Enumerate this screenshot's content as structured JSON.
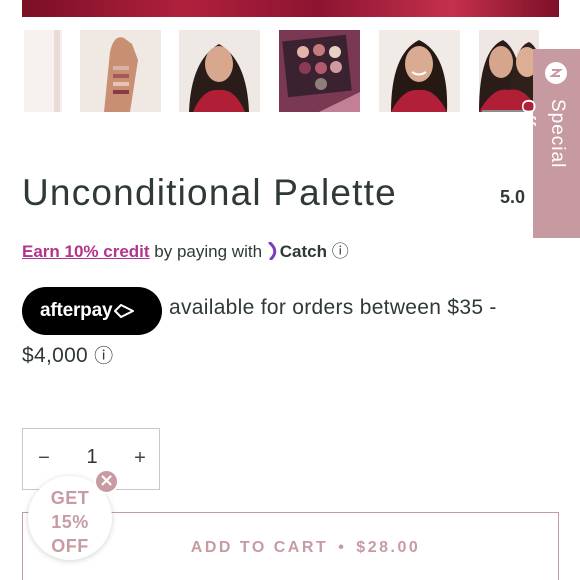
{
  "product": {
    "title": "Unconditional Palette",
    "rating": "5.0"
  },
  "thumbnail_nav": {
    "prev_arrow": "‹",
    "thumbnails": [
      {
        "name": "thumb-product-stick"
      },
      {
        "name": "thumb-arm-swatches"
      },
      {
        "name": "thumb-model-portrait"
      },
      {
        "name": "thumb-palette-open"
      },
      {
        "name": "thumb-model-smiling"
      },
      {
        "name": "thumb-two-models"
      }
    ]
  },
  "special_offers": {
    "label": "Special Offers",
    "icon": "gift-icon"
  },
  "catch_promo": {
    "earn_link": "Earn 10% credit",
    "text": "by paying with",
    "brand": "Catch",
    "info_icon": "ⓘ"
  },
  "afterpay": {
    "badge": "afterpay",
    "text_line1": "available for orders between $35 -",
    "text_line2": "$4,000",
    "info_icon": "ⓘ"
  },
  "quantity": {
    "minus": "−",
    "value": "1",
    "plus": "+"
  },
  "add_to_cart": {
    "label": "ADD TO CART",
    "separator": "•",
    "price": "$28.00"
  },
  "discount_popup": {
    "line1": "GET",
    "line2": "15%",
    "line3": "OFF",
    "close": "×"
  },
  "colors": {
    "accent_pink": "#c89ba3",
    "earn_magenta": "#b3348a",
    "text_dark": "#2f3a35",
    "afterpay_black": "#000000"
  }
}
